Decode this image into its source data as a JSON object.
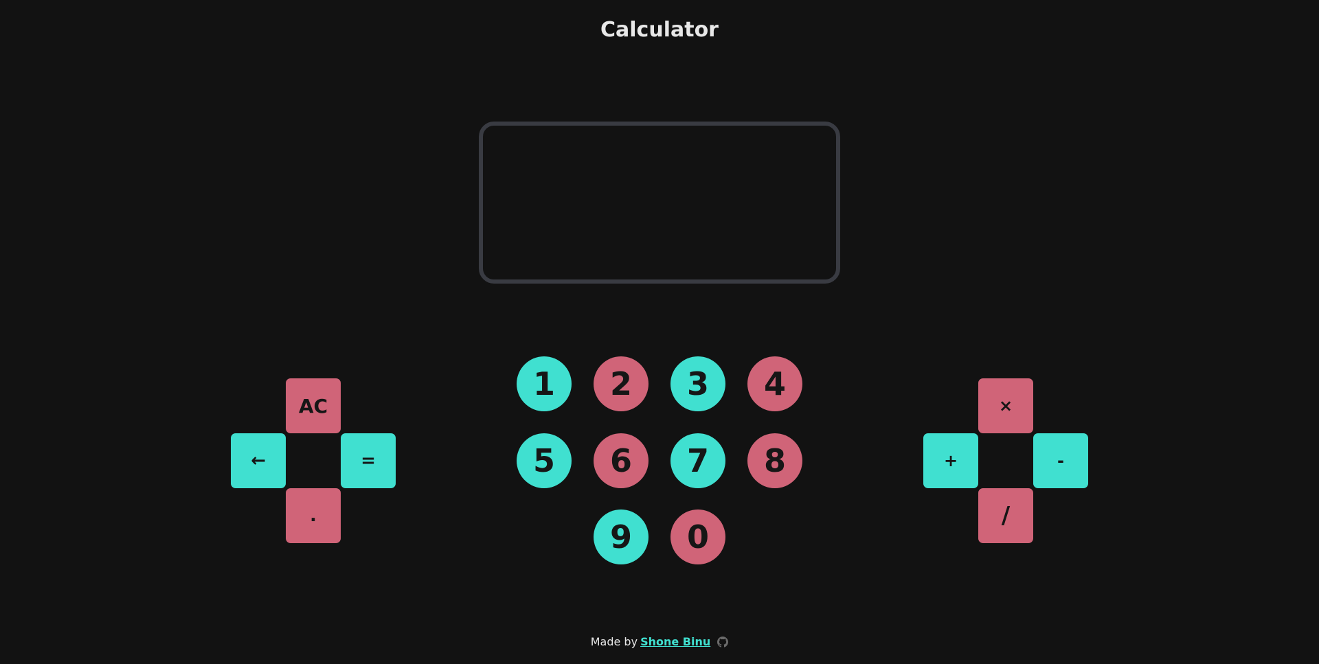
{
  "app": {
    "title": "Calculator"
  },
  "display": {
    "value": ""
  },
  "keypad": {
    "control": {
      "ac": "AC",
      "backspace": "←",
      "equals": "=",
      "dot": "."
    },
    "digits": [
      "1",
      "2",
      "3",
      "4",
      "5",
      "6",
      "7",
      "8",
      "9",
      "0"
    ],
    "operators": {
      "multiply": "×",
      "add": "+",
      "subtract": "-",
      "divide": "/"
    }
  },
  "footer": {
    "prefix": "Made by",
    "author": "Shone Binu",
    "icon": "github-icon"
  },
  "colors": {
    "background": "#121212",
    "teal": "#40e0d0",
    "pink": "#d06478",
    "display_border": "#393b42"
  }
}
